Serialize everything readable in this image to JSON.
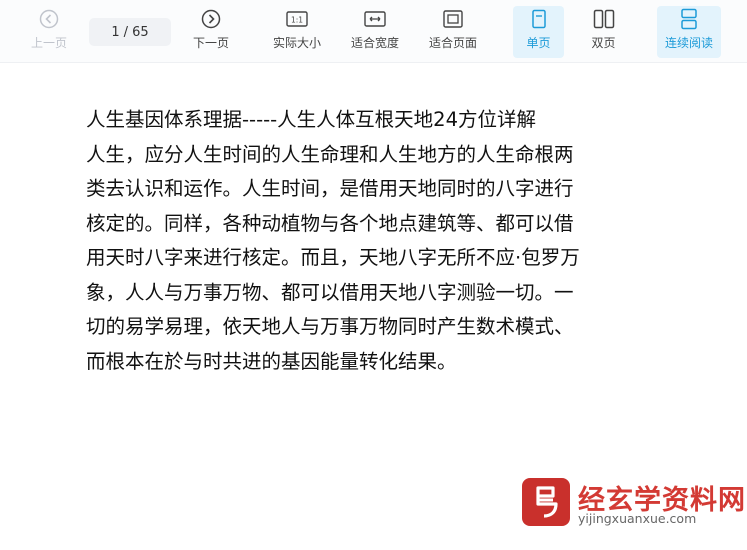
{
  "toolbar": {
    "prev_label": "上一页",
    "page_current": "1",
    "page_separator": "/",
    "page_total": "65",
    "next_label": "下一页",
    "actual_size_label": "实际大小",
    "fit_width_label": "适合宽度",
    "fit_page_label": "适合页面",
    "single_page_label": "单页",
    "double_page_label": "双页",
    "continuous_label": "连续阅读",
    "active_color": "#1d9bd8",
    "active_bg": "#e3f3fc"
  },
  "document": {
    "lines": [
      "人生基因体系理据-----人生人体互根天地24方位详解",
      "人生，应分人生时间的人生命理和人生地方的人生命根两",
      "类去认识和运作。人生时间，是借用天地同时的八字进行",
      "核定的。同样，各种动植物与各个地点建筑等、都可以借",
      "用天时八字来进行核定。而且，天地八字无所不应·包罗万",
      "象，人人与万事万物、都可以借用天地八字测验一切。一",
      "切的易学易理，依天地人与万事万物同时产生数术模式、",
      "而根本在於与时共进的基因能量转化结果。"
    ]
  },
  "watermark": {
    "name": "经玄学资料网",
    "url": "yijingxuanxue.com",
    "color": "#d33a34"
  }
}
